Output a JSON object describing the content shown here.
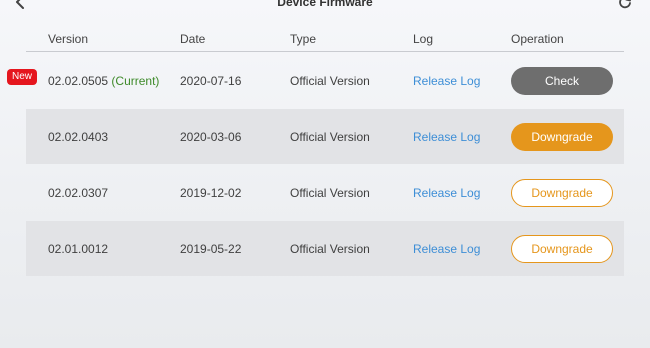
{
  "header": {
    "title": "Device Firmware",
    "back_icon": "chevron-left-icon",
    "refresh_icon": "refresh-icon"
  },
  "table": {
    "columns": [
      "Version",
      "Date",
      "Type",
      "Log",
      "Operation"
    ],
    "rows": [
      {
        "version": "02.02.0505",
        "current_label": "(Current)",
        "date": "2020-07-16",
        "type": "Official Version",
        "log": "Release Log",
        "operation": "Check"
      },
      {
        "version": "02.02.0403",
        "current_label": "",
        "date": "2020-03-06",
        "type": "Official Version",
        "log": "Release Log",
        "operation": "Downgrade"
      },
      {
        "version": "02.02.0307",
        "current_label": "",
        "date": "2019-12-02",
        "type": "Official Version",
        "log": "Release Log",
        "operation": "Downgrade"
      },
      {
        "version": "02.01.0012",
        "current_label": "",
        "date": "2019-05-22",
        "type": "Official Version",
        "log": "Release Log",
        "operation": "Downgrade"
      }
    ]
  },
  "badge": {
    "new_label": "New"
  },
  "colors": {
    "accent": "#e5961c",
    "link": "#3d8ed6",
    "current": "#3e8a2a",
    "badge": "#e5161e",
    "check_button": "#6e6e6e"
  }
}
